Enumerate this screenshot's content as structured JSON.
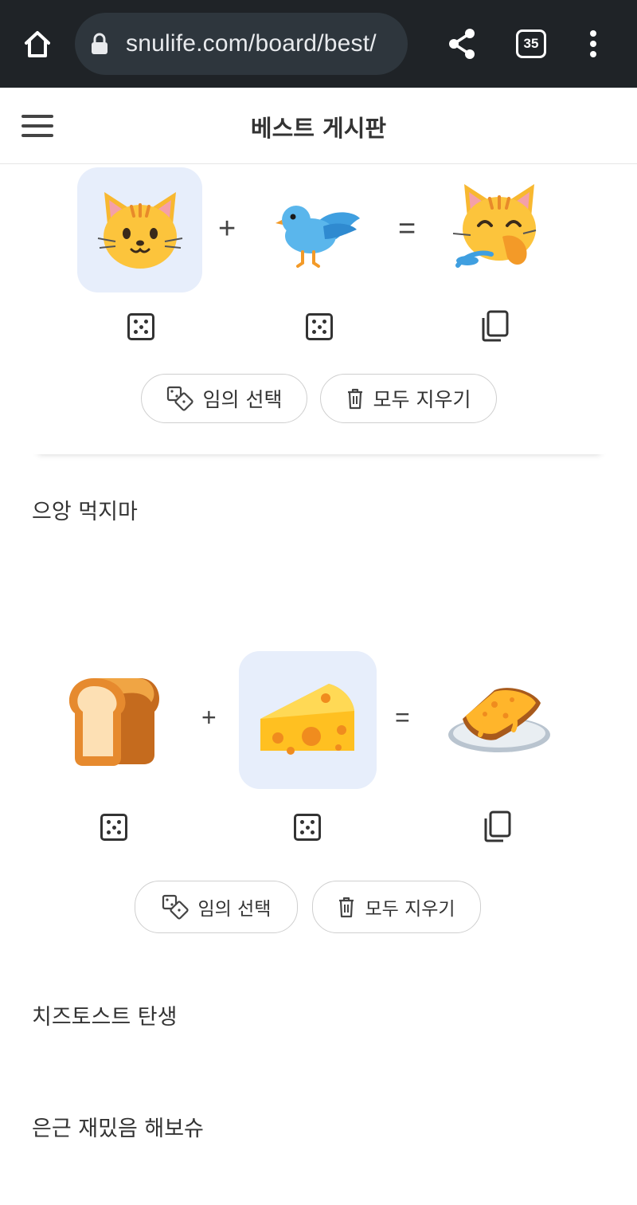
{
  "browser": {
    "url": "snulife.com/board/best/",
    "tab_count": "35"
  },
  "header": {
    "title": "베스트 게시판"
  },
  "combo1": {
    "plus": "+",
    "equals": "=",
    "random_label": "임의 선택",
    "clear_label": "모두 지우기"
  },
  "caption1": "으앙 먹지마",
  "combo2": {
    "plus": "+",
    "equals": "=",
    "random_label": "임의 선택",
    "clear_label": "모두 지우기"
  },
  "caption2": "치즈토스트 탄생",
  "caption3": "은근 재밌음 해보슈",
  "icons": {
    "home": "home-icon",
    "lock": "lock-icon",
    "share": "share-icon",
    "tabs": "tab-switcher-icon",
    "menu": "more-vert-icon",
    "hamburger": "hamburger-menu-icon",
    "dice": "dice-icon",
    "copy": "copy-icon",
    "random": "random-dice-icon",
    "trash": "trash-icon"
  }
}
